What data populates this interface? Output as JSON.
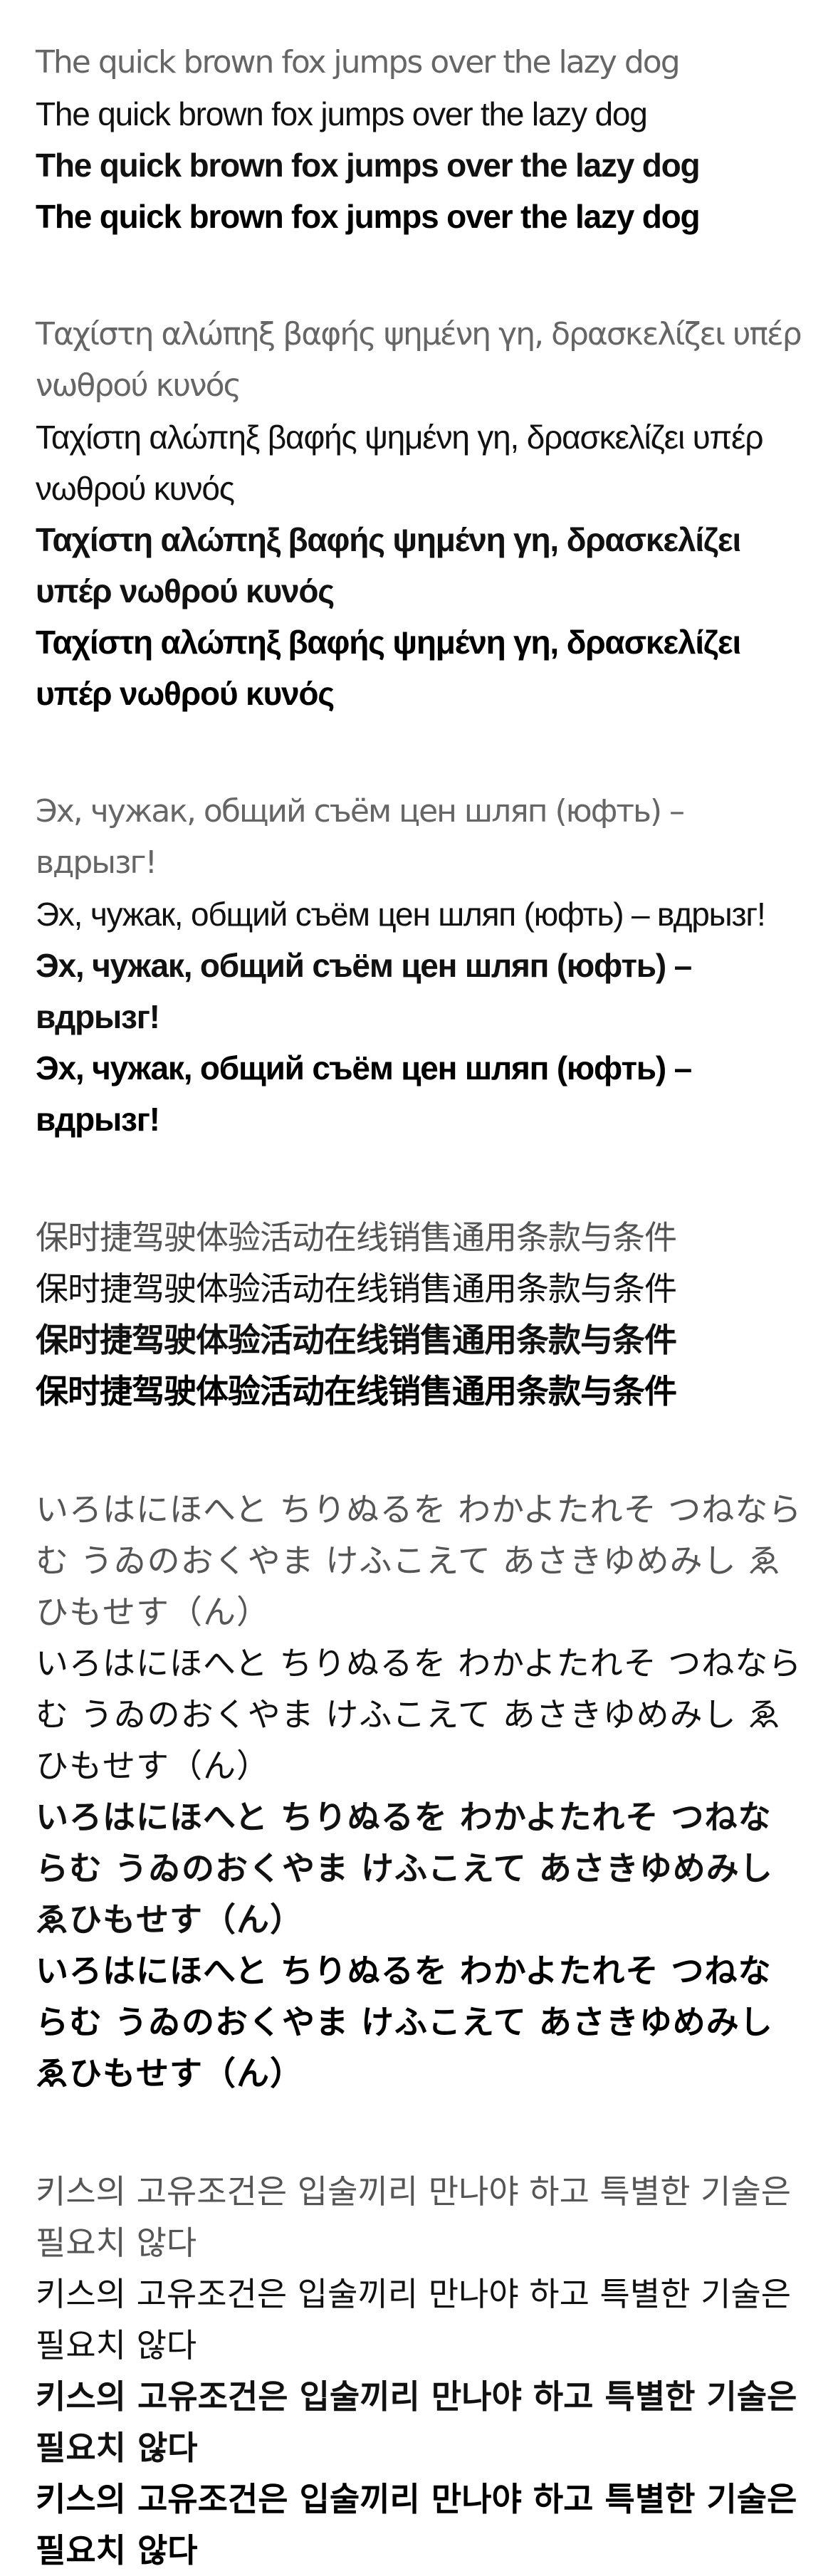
{
  "specimens": [
    {
      "id": "latin",
      "lines": [
        "The quick brown fox jumps over the lazy dog",
        "The quick brown fox jumps over the lazy dog",
        "The quick brown fox jumps over the lazy dog",
        "The quick brown fox jumps over the lazy dog"
      ]
    },
    {
      "id": "greek",
      "lines": [
        "Ταχίστη αλώπηξ βαφής ψημένη γη, δρασκελίζει υπέρ νωθρού κυνός",
        "Ταχίστη αλώπηξ βαφής ψημένη γη, δρασκελίζει υπέρ νωθρού κυνός",
        "Ταχίστη αλώπηξ βαφής ψημένη γη, δρασκελίζει υπέρ νωθρού κυνός",
        "Ταχίστη αλώπηξ βαφής ψημένη γη, δρασκελίζει υπέρ νωθρού κυνός"
      ]
    },
    {
      "id": "cyrillic",
      "lines": [
        "Эх, чужак, общий съём цен шляп (юфть) – вдрызг!",
        "Эх, чужак, общий съём цен шляп (юфть) – вдрызг!",
        "Эх, чужак, общий съём цен шляп (юфть) – вдрызг!",
        "Эх, чужак, общий съём цен шляп (юфть) – вдрызг!"
      ]
    },
    {
      "id": "chinese",
      "lines": [
        "保时捷驾驶体验活动在线销售通用条款与条件",
        "保时捷驾驶体验活动在线销售通用条款与条件",
        "保时捷驾驶体验活动在线销售通用条款与条件",
        "保时捷驾驶体验活动在线销售通用条款与条件"
      ]
    },
    {
      "id": "japanese",
      "lines": [
        "いろはにほへと ちりぬるを わかよたれそ つねならむ うゐのおくやま けふこえて あさきゆめみし ゑひもせす（ん）",
        "いろはにほへと ちりぬるを わかよたれそ つねならむ うゐのおくやま けふこえて あさきゆめみし ゑひもせす（ん）",
        "いろはにほへと ちりぬるを わかよたれそ つねならむ うゐのおくやま けふこえて あさきゆめみし ゑひもせす（ん）",
        "いろはにほへと ちりぬるを わかよたれそ つねならむ うゐのおくやま けふこえて あさきゆめみし ゑひもせす（ん）"
      ]
    },
    {
      "id": "korean",
      "lines": [
        "키스의 고유조건은 입술끼리 만나야 하고 특별한 기술은 필요치 않다",
        "키스의 고유조건은 입술끼리 만나야 하고 특별한 기술은 필요치 않다",
        "키스의 고유조건은 입술끼리 만나야 하고 특별한 기술은 필요치 않다",
        "키스의 고유조건은 입술끼리 만나야 하고 특별한 기술은 필요치 않다"
      ]
    }
  ],
  "colors": {
    "background": "#ffffff",
    "light_text": "#666666",
    "text": "#111111"
  }
}
